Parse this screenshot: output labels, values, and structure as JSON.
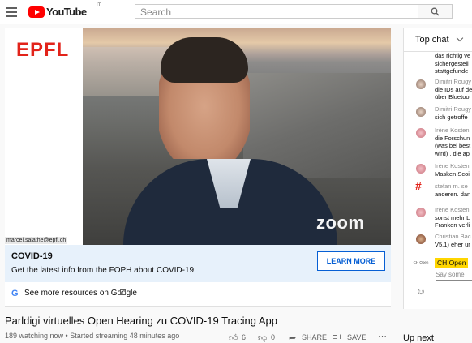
{
  "header": {
    "logo_text": "YouTube",
    "country_code": "IT",
    "search_placeholder": "Search"
  },
  "video": {
    "epfl_logo": "EPFL",
    "zoom_logo": "zoom",
    "email_label": "marcel.salathe@epfl.ch"
  },
  "info_panel": {
    "title": "COVID-19",
    "description": "Get the latest info from the FOPH about COVID-19",
    "learn_more_label": "LEARN MORE",
    "more_resources": "See more resources on Google"
  },
  "video_meta": {
    "title": "Parldigi virtuelles Open Hearing zu COVID-19 Tracing App",
    "stats": "189 watching now • Started streaming 48 minutes ago",
    "likes": "6",
    "dislikes": "0",
    "share_label": "SHARE",
    "save_label": "SAVE"
  },
  "chat": {
    "title": "Top chat",
    "messages": [
      {
        "author": "",
        "lines": [
          "das richtig ve",
          "sichergestell",
          "stattgefunde"
        ]
      },
      {
        "author": "Dimitri Rougy",
        "lines": [
          "die IDs auf de",
          "über Bluetoo"
        ]
      },
      {
        "author": "Dimitri Rougy",
        "lines": [
          "sich getroffe"
        ]
      },
      {
        "author": "Irène Kosten",
        "lines": [
          "die Forschun",
          "(was bei best",
          "wird) , die ap"
        ]
      },
      {
        "author": "Irène Kosten",
        "lines": [
          "Masken,Scoi"
        ]
      },
      {
        "author": "stefan m. se",
        "lines": [
          "anderen. dan"
        ]
      },
      {
        "author": "Irène Kosten",
        "lines": [
          "sonst mehr L",
          "Franken verli"
        ]
      },
      {
        "author": "Christian Bac",
        "lines": [
          "V5.1) eher ur"
        ]
      }
    ],
    "ch_open_logo": "CH Open",
    "ch_open_badge": "CH Open",
    "input_placeholder": "Say some"
  },
  "sidebar": {
    "up_next": "Up next"
  }
}
